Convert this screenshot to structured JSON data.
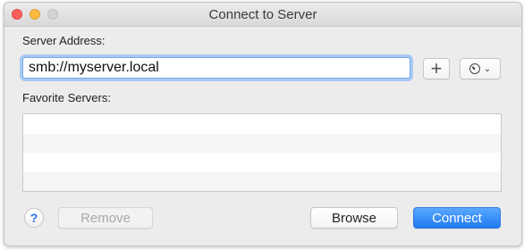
{
  "window": {
    "title": "Connect to Server"
  },
  "server_address": {
    "label": "Server Address:",
    "value": "smb://myserver.local",
    "add_symbol": "+",
    "history_icon": "clock-icon",
    "history_chevron": "⌄"
  },
  "favorites": {
    "label": "Favorite Servers:",
    "items": []
  },
  "footer": {
    "help_symbol": "?",
    "remove_label": "Remove",
    "browse_label": "Browse",
    "connect_label": "Connect"
  },
  "colors": {
    "accent": "#1f7bf2",
    "close": "#fc605c",
    "minimize": "#fdbc40",
    "zoom": "#d3d3d3"
  }
}
